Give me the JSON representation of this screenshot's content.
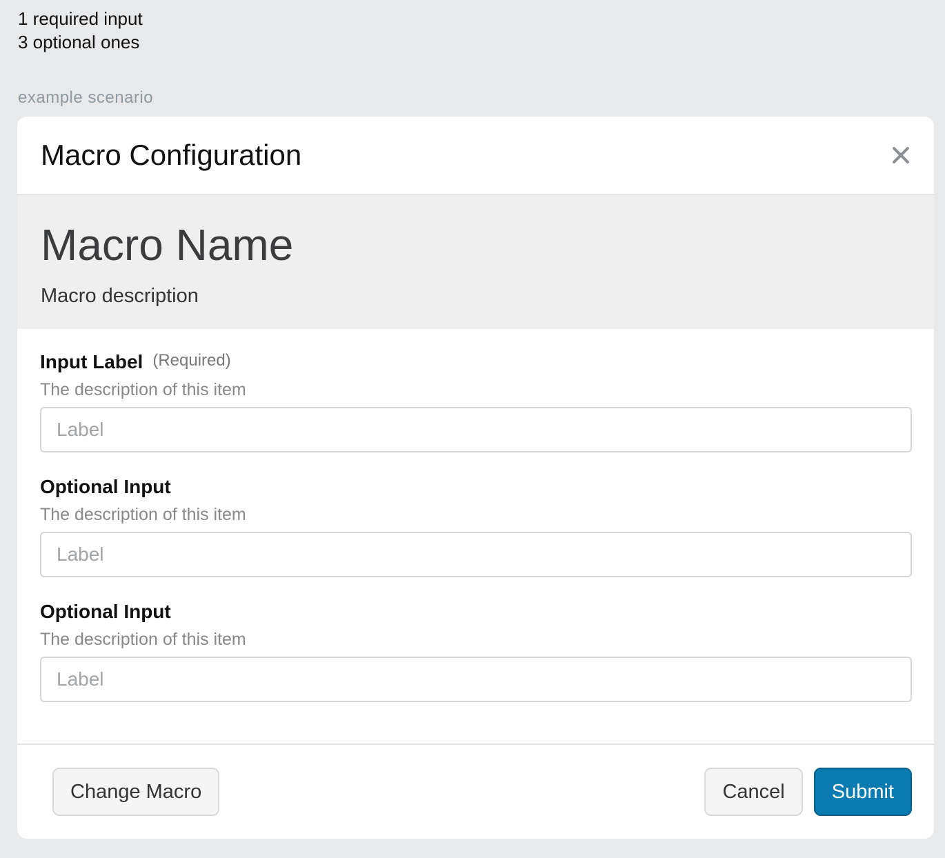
{
  "notes": {
    "line1": "1 required input",
    "line2": "3 optional ones"
  },
  "scenario_label": "example scenario",
  "modal": {
    "title": "Macro Configuration",
    "close_icon": "close-icon"
  },
  "macro": {
    "name": "Macro Name",
    "description": "Macro description"
  },
  "fields": [
    {
      "label": "Input Label",
      "required_text": "(Required)",
      "description": "The description of this item",
      "placeholder": "Label"
    },
    {
      "label": "Optional Input",
      "description": "The description of this item",
      "placeholder": "Label"
    },
    {
      "label": "Optional Input",
      "description": "The description of this item",
      "placeholder": "Label"
    }
  ],
  "footer": {
    "change_macro_label": "Change Macro",
    "cancel_label": "Cancel",
    "submit_label": "Submit"
  },
  "colors": {
    "primary": "#0a7bb0",
    "page_background": "#e8e9eb",
    "macro_info_background": "#efeff0"
  }
}
